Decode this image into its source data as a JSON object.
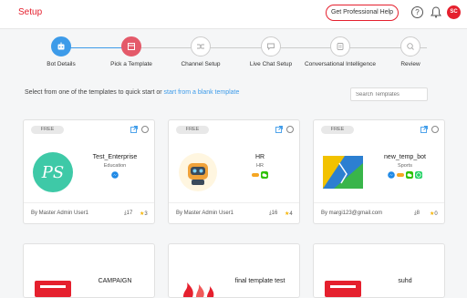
{
  "header": {
    "title": "Setup",
    "pro_button": "Get Professional Help",
    "help_glyph": "?",
    "avatar_initials": "SC"
  },
  "steps": [
    {
      "label": "Bot Details",
      "state": "done",
      "icon": "bot-icon"
    },
    {
      "label": "Pick a Template",
      "state": "active",
      "icon": "template-icon"
    },
    {
      "label": "Channel Setup",
      "state": "pending",
      "icon": "shuffle-icon"
    },
    {
      "label": "Live Chat Setup",
      "state": "pending",
      "icon": "chat-icon"
    },
    {
      "label": "Conversational Intelligence",
      "state": "pending",
      "icon": "brain-icon"
    },
    {
      "label": "Review",
      "state": "pending",
      "icon": "review-icon"
    }
  ],
  "instruction": {
    "prefix": "Select from one of the templates to quick start or ",
    "link": "start from a blank template"
  },
  "search": {
    "placeholder": "Search Templates"
  },
  "cards": [
    {
      "badge": "FREE",
      "name": "Test_Enterprise",
      "category": "Education",
      "author": "By Master Admin User1",
      "downloads": "17",
      "stars": "3",
      "logo": "ps-logo-icon",
      "channels": [
        "messenger"
      ]
    },
    {
      "badge": "FREE",
      "name": "HR",
      "category": "HR",
      "author": "By Master Admin User1",
      "downloads": "16",
      "stars": "4",
      "logo": "robot-logo-icon",
      "channels": [
        "link",
        "wechat"
      ]
    },
    {
      "badge": "FREE",
      "name": "new_temp_bot",
      "category": "Sports",
      "author": "By margi123@gmail.com",
      "downloads": "8",
      "stars": "0",
      "logo": "sports-logo-icon",
      "channels": [
        "messenger",
        "link",
        "wechat",
        "whatsapp"
      ]
    },
    {
      "badge": "",
      "name": "CAMPAIGN",
      "category": "",
      "author": "",
      "downloads": "",
      "stars": "",
      "logo": "campaign-logo-icon",
      "channels": []
    },
    {
      "badge": "",
      "name": "final template test",
      "category": "",
      "author": "",
      "downloads": "",
      "stars": "",
      "logo": "final-logo-icon",
      "channels": []
    },
    {
      "badge": "",
      "name": "suhd",
      "category": "",
      "author": "",
      "downloads": "",
      "stars": "",
      "logo": "suhd-logo-icon",
      "channels": []
    }
  ],
  "colors": {
    "brand": "#e5202e",
    "accent": "#3d9be9",
    "active_step": "#e45a6a"
  }
}
